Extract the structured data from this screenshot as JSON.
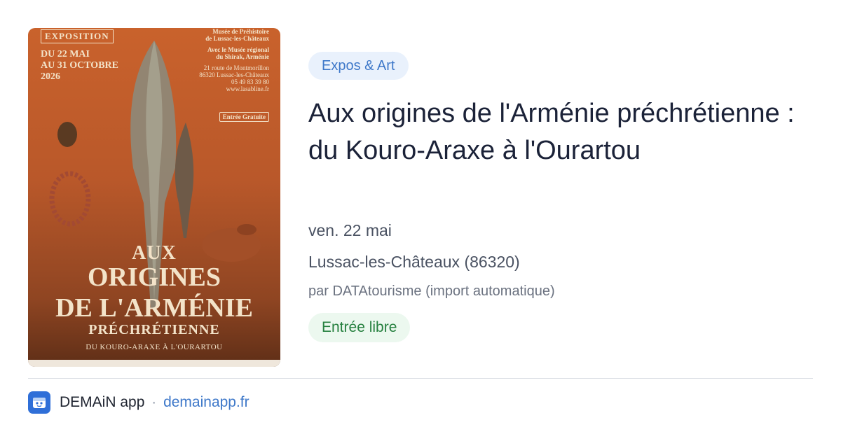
{
  "poster": {
    "expo_label": "EXPOSITION",
    "dates": [
      "DU 22 MAI",
      "AU 31 OCTOBRE",
      "2026"
    ],
    "museum_lines": [
      "Musée de Préhistoire",
      "de Lussac-les-Châteaux"
    ],
    "partner_lines": [
      "Avec le Musée régional",
      "du Shirak, Arménie"
    ],
    "address_lines": [
      "21 route de Montmorillon",
      "86320 Lussac-les-Châteaux",
      "05 49 83 39 80",
      "www.lasabline.fr"
    ],
    "entree": "Entrée Gratuite",
    "title_lines": [
      "AUX",
      "ORIGINES",
      "DE L'ARMÉNIE",
      "PRÉCHRÉTIENNE"
    ],
    "subtitle": "DU KOURO-ARAXE À L'OURARTOU"
  },
  "event": {
    "category": "Expos & Art",
    "title": "Aux origines de l'Arménie préchrétienne : du Kouro-Araxe à l'Ourartou",
    "date": "ven. 22 mai",
    "location": "Lussac-les-Châteaux (86320)",
    "author": "par DATAtourisme (import automatique)",
    "price": "Entrée libre"
  },
  "footer": {
    "app_name": "DEMAiN app",
    "separator": "·",
    "site": "demainapp.fr"
  },
  "colors": {
    "tag_bg": "#e9f1fc",
    "tag_text": "#3e78c9",
    "price_bg": "#ecf8ef",
    "price_text": "#26803f",
    "title_text": "#1b2238",
    "poster_orange": "#c9622c"
  }
}
